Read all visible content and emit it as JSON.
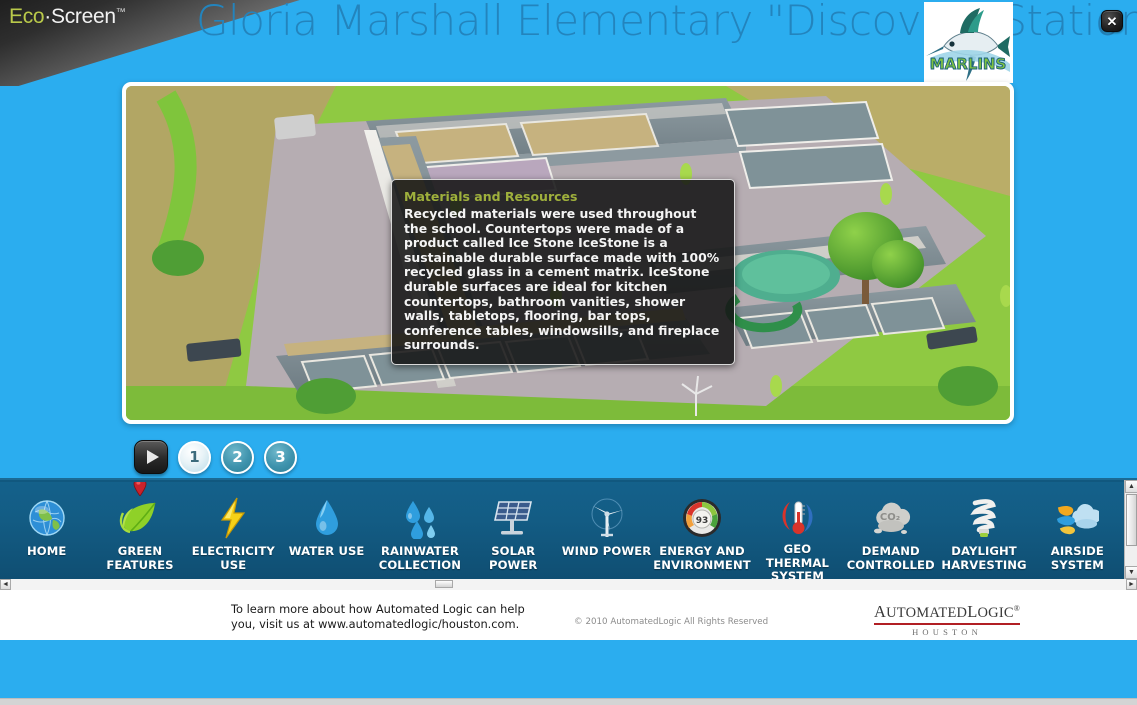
{
  "header": {
    "brand_eco": "Eco",
    "brand_dot": "·",
    "brand_screen": "Screen",
    "brand_tm": "™",
    "title": "Gloria Marshall Elementary \"Discovery Station\"",
    "logo_name": "marlins-school-logo",
    "logo_text": "MARLINS",
    "close_label": "✕",
    "bg_color": "#2badef",
    "title_color": "#2384bd"
  },
  "viewer": {
    "name": "school-3d-floorplan",
    "tooltip": {
      "title": "Materials and Resources",
      "body": "Recycled materials were used throughout the school. Countertops were made of a product called Ice Stone IceStone is a sustainable durable surface made with 100% recycled glass in a cement matrix. IceStone durable surfaces are ideal for kitchen countertops, bathroom vanities, shower walls, tabletops, flooring, bar tops, conference tables, windowsills, and fireplace surrounds.",
      "title_color": "#9fb03c"
    }
  },
  "controls": {
    "play_label": "play",
    "steps": [
      {
        "label": "1",
        "active": true
      },
      {
        "label": "2",
        "active": false
      },
      {
        "label": "3",
        "active": false
      }
    ]
  },
  "nav": {
    "active_index": 1,
    "items": [
      {
        "label": "HOME",
        "icon": "globe-icon"
      },
      {
        "label": "GREEN\nFEATURES",
        "icon": "leaf-icon"
      },
      {
        "label": "ELECTRICITY\nUSE",
        "icon": "lightning-bolt-icon"
      },
      {
        "label": "WATER USE",
        "icon": "water-drop-icon"
      },
      {
        "label": "RAINWATER\nCOLLECTION",
        "icon": "rain-drops-icon"
      },
      {
        "label": "SOLAR POWER",
        "icon": "solar-panel-icon"
      },
      {
        "label": "WIND POWER",
        "icon": "wind-turbine-icon"
      },
      {
        "label": "ENERGY AND\nENVIRONMENT",
        "icon": "gauge-icon"
      },
      {
        "label": "GEO THERMAL\nSYSTEM",
        "icon": "thermometer-icon"
      },
      {
        "label": "DEMAND\nCONTROLLED",
        "icon": "co2-cloud-icon"
      },
      {
        "label": "DAYLIGHT\nHARVESTING",
        "icon": "cfl-bulb-icon"
      },
      {
        "label": "AIRSIDE\nSYSTEM",
        "icon": "airflow-cloud-icon"
      }
    ],
    "bar_color": "#11587f"
  },
  "footer": {
    "contact_text": "To learn more about how Automated Logic can help you, visit us at www.automatedlogic/houston.com.",
    "copyright": "© 2010 AutomatedLogic All Rights Reserved",
    "logo_line1_small": "UTOMATED",
    "logo_line1_a": "A",
    "logo_line1_l": "L",
    "logo_line1_ogic": "OGIC",
    "logo_tm": "®",
    "logo_sub": "HOUSTON",
    "rule_color": "#b11f24"
  },
  "scrollbars": {
    "v_up": "▲",
    "v_down": "▼",
    "h_left": "◄",
    "h_right": "►"
  }
}
